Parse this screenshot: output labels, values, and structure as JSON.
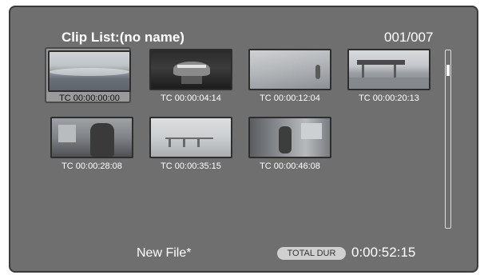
{
  "header": {
    "title": "Clip List:(no name)",
    "counter": "001/007"
  },
  "clips": [
    {
      "timecode": "TC 00:00:00:00",
      "selected": true
    },
    {
      "timecode": "TC 00:00:04:14",
      "selected": false
    },
    {
      "timecode": "TC 00:00:12:04",
      "selected": false
    },
    {
      "timecode": "TC 00:00:20:13",
      "selected": false
    },
    {
      "timecode": "TC 00:00:28:08",
      "selected": false
    },
    {
      "timecode": "TC 00:00:35:15",
      "selected": false
    },
    {
      "timecode": "TC 00:00:46:08",
      "selected": false
    }
  ],
  "footer": {
    "file_name": "New File*",
    "total_dur_label": "TOTAL DUR",
    "total_dur_value": "0:00:52:15"
  },
  "colors": {
    "background": "#6f6f6f",
    "text": "#ffffff",
    "selected_tile": "#9a9a9a",
    "badge": "#d0d0d0"
  }
}
